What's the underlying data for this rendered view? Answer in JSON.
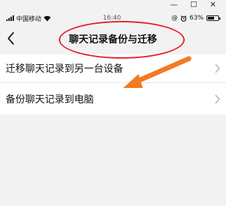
{
  "window": {
    "minimize_glyph": "—",
    "maximize_glyph": "☐",
    "close_glyph": "✕"
  },
  "status_bar": {
    "carrier": "中国移动",
    "time": "16:40",
    "battery_percent_text": "63%",
    "battery_level": 0.63
  },
  "nav": {
    "title": "聊天记录备份与迁移"
  },
  "menu": {
    "items": [
      {
        "label": "迁移聊天记录到另一台设备"
      },
      {
        "label": "备份聊天记录到电脑"
      }
    ]
  },
  "annotations": {
    "highlight_color": "#e8202a",
    "arrow_color": "#f47b20"
  },
  "icons": {
    "back": "chevron-left-icon",
    "item_arrow": "chevron-right-icon",
    "wifi": "wifi-icon",
    "alarm": "alarm-clock-icon",
    "at": "at-sign-icon",
    "battery": "battery-icon",
    "signal": "signal-bars-icon"
  }
}
